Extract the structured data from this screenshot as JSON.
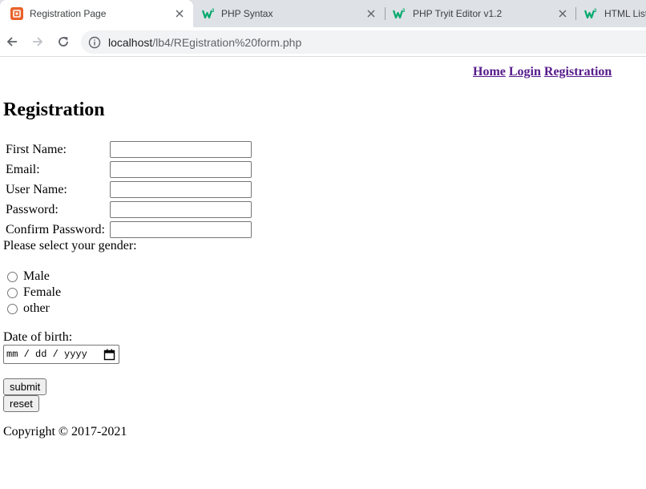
{
  "browser": {
    "tabs": [
      {
        "title": "Registration Page",
        "active": true
      },
      {
        "title": "PHP Syntax",
        "active": false
      },
      {
        "title": "PHP Tryit Editor v1.2",
        "active": false
      },
      {
        "title": "HTML Lists",
        "active": false
      }
    ],
    "url": {
      "host": "localhost",
      "path": "/lb4/REgistration%20form.php"
    }
  },
  "nav": {
    "home": "Home",
    "login": "Login",
    "registration": "Registration"
  },
  "page": {
    "heading": "Registration"
  },
  "form": {
    "fields": [
      {
        "label": "First Name:",
        "value": ""
      },
      {
        "label": "Email:",
        "value": ""
      },
      {
        "label": "User Name:",
        "value": ""
      },
      {
        "label": "Password:",
        "value": ""
      },
      {
        "label": "Confirm Password:",
        "value": ""
      }
    ],
    "gender_prompt": "Please select your gender:",
    "genders": [
      "Male",
      "Female",
      "other"
    ],
    "dob_label": "Date of birth:",
    "dob_placeholder": "mm / dd / yyyy",
    "submit_label": "submit",
    "reset_label": "reset"
  },
  "footer": {
    "copyright": "Copyright © 2017-2021"
  },
  "colors": {
    "link_visited": "#551a8b",
    "tab_bar": "#dee1e6",
    "w3_green": "#04aa6d",
    "favicon_orange": "#e8622c"
  }
}
